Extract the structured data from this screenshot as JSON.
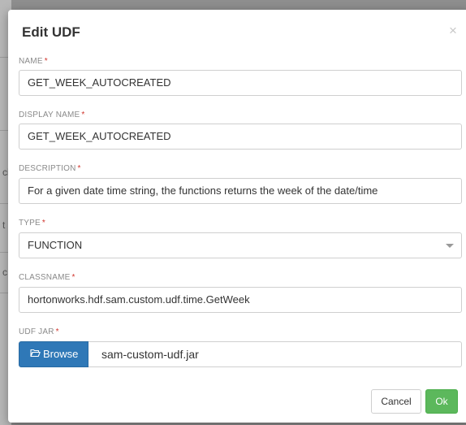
{
  "background": {
    "chars": [
      "ci",
      "t",
      "c"
    ]
  },
  "modal": {
    "title": "Edit UDF",
    "close_symbol": "×",
    "required_marker": "*"
  },
  "fields": {
    "name": {
      "label": "NAME",
      "value": "GET_WEEK_AUTOCREATED"
    },
    "display_name": {
      "label": "DISPLAY NAME",
      "value": "GET_WEEK_AUTOCREATED"
    },
    "description": {
      "label": "DESCRIPTION",
      "value": "For a given date time string, the functions returns the week of the date/time"
    },
    "type": {
      "label": "TYPE",
      "value": "FUNCTION"
    },
    "classname": {
      "label": "CLASSNAME",
      "value": "hortonworks.hdf.sam.custom.udf.time.GetWeek"
    },
    "udf_jar": {
      "label": "UDF JAR",
      "browse_label": "Browse",
      "file_name": "sam-custom-udf.jar"
    }
  },
  "footer": {
    "cancel_label": "Cancel",
    "ok_label": "Ok"
  },
  "colors": {
    "primary": "#2f78b7",
    "success": "#5cb85c",
    "required": "#d0342c"
  },
  "icons": {
    "close": "close-icon",
    "browse": "folder-open-icon",
    "select": "chevron-down-icon"
  }
}
